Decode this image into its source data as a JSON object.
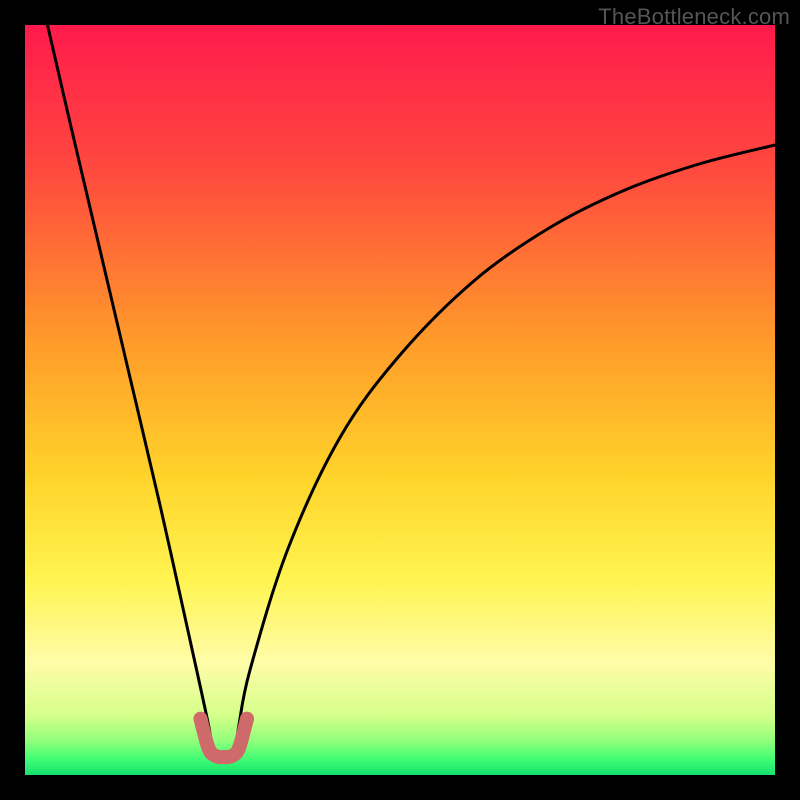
{
  "watermark": {
    "text": "TheBottleneck.com"
  },
  "chart_data": {
    "type": "line",
    "title": "",
    "xlabel": "",
    "ylabel": "",
    "xlim": [
      0,
      1
    ],
    "ylim": [
      0,
      1
    ],
    "series": [
      {
        "name": "bottleneck-curve",
        "x": [
          0.03,
          0.06,
          0.1,
          0.14,
          0.18,
          0.22,
          0.245,
          0.25,
          0.255,
          0.26,
          0.27,
          0.28,
          0.285,
          0.3,
          0.35,
          0.42,
          0.5,
          0.6,
          0.7,
          0.8,
          0.9,
          1.0
        ],
        "y": [
          1.0,
          0.87,
          0.7,
          0.53,
          0.36,
          0.18,
          0.065,
          0.03,
          0.025,
          0.025,
          0.025,
          0.03,
          0.065,
          0.14,
          0.3,
          0.45,
          0.56,
          0.66,
          0.73,
          0.78,
          0.815,
          0.84
        ]
      },
      {
        "name": "valley-highlight",
        "x": [
          0.234,
          0.245,
          0.255,
          0.265,
          0.275,
          0.285,
          0.296
        ],
        "y": [
          0.075,
          0.035,
          0.025,
          0.024,
          0.025,
          0.035,
          0.075
        ]
      }
    ],
    "gradient_stops": [
      {
        "pos": 0.0,
        "color": "#ff1a4c"
      },
      {
        "pos": 0.2,
        "color": "#ff4b3e"
      },
      {
        "pos": 0.42,
        "color": "#ff9a2a"
      },
      {
        "pos": 0.6,
        "color": "#ffd32a"
      },
      {
        "pos": 0.74,
        "color": "#fff450"
      },
      {
        "pos": 0.85,
        "color": "#fffca8"
      },
      {
        "pos": 0.92,
        "color": "#d6ff8a"
      },
      {
        "pos": 0.955,
        "color": "#8fff7a"
      },
      {
        "pos": 0.98,
        "color": "#3dfc74"
      },
      {
        "pos": 1.0,
        "color": "#14e06f"
      }
    ],
    "colors": {
      "curve": "#000000",
      "highlight": "#cf6a6a",
      "frame": "#000000"
    }
  }
}
